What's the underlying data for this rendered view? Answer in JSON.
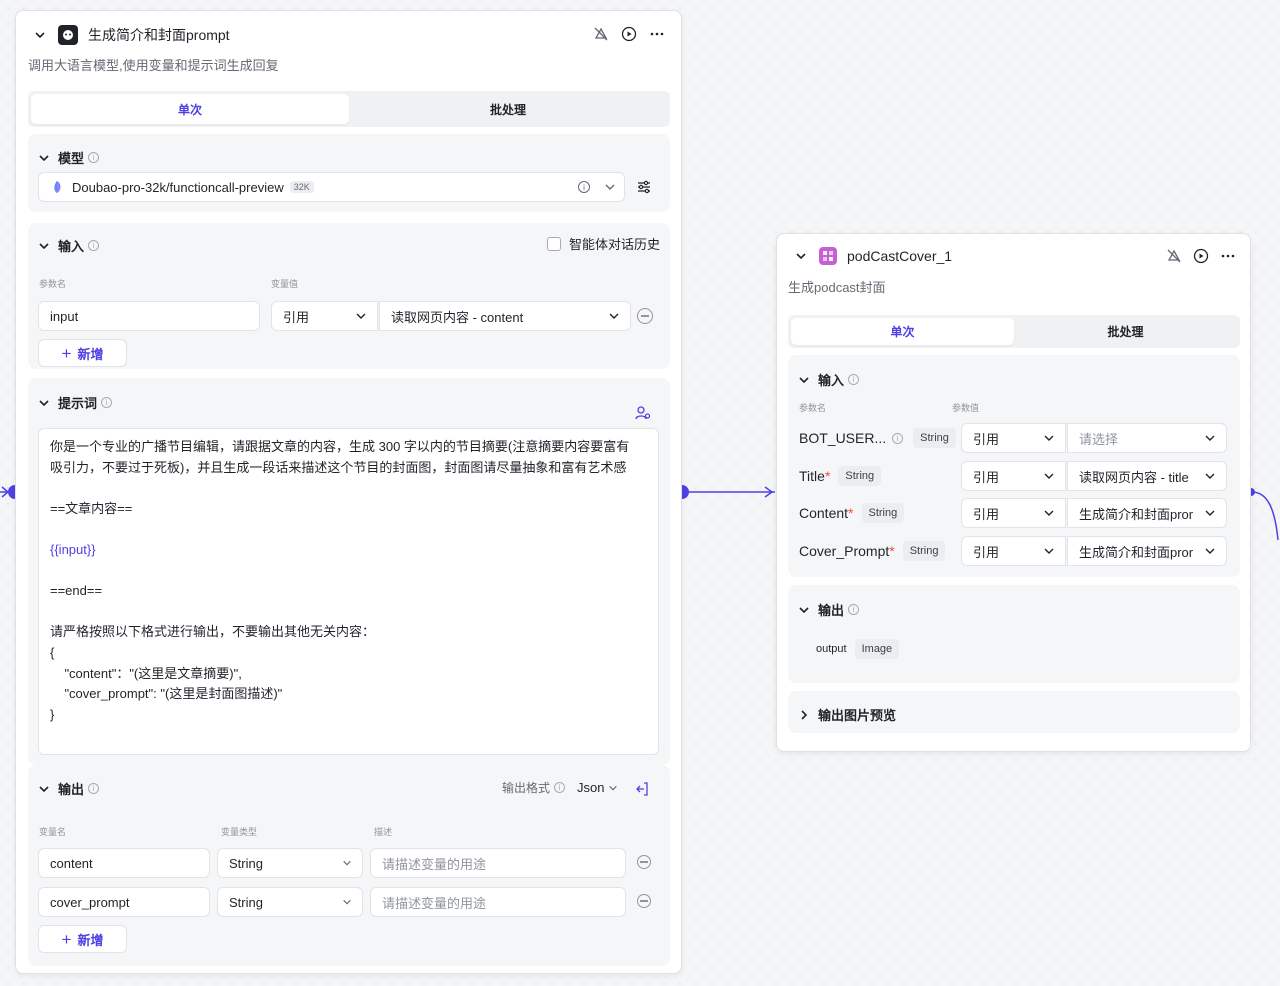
{
  "node1": {
    "title": "生成简介和封面prompt",
    "description": "调用大语言模型,使用变量和提示词生成回复",
    "tabs": [
      "单次",
      "批处理"
    ],
    "model": {
      "section_title": "模型",
      "name": "Doubao-pro-32k/functioncall-preview",
      "badge": "32K"
    },
    "input": {
      "section_title": "输入",
      "chat_history_label": "智能体对话历史",
      "col_param": "参数名",
      "col_value": "变量值",
      "rows": [
        {
          "name": "input",
          "type": "引用",
          "value": "读取网页内容 - content"
        }
      ],
      "add_label": "新增"
    },
    "prompt": {
      "section_title": "提示词",
      "line1": "你是一个专业的广播节目编辑，请跟据文章的内容，生成 300 字以内的节目摘要(注意摘要内容要富有",
      "line2": "吸引力，不要过于死板)，并且生成一段话来描述这个节目的封面图，封面图请尽量抽象和富有艺术感",
      "line3": "==文章内容==",
      "var": "{{input}}",
      "line4": "==end==",
      "line5": "请严格按照以下格式进行输出，不要输出其他无关内容：",
      "line6": "{",
      "line7": "    \"content\"：\"(这里是文章摘要)\",",
      "line8": "    \"cover_prompt\": \"(这里是封面图描述)\"",
      "line9": "}"
    },
    "output": {
      "section_title": "输出",
      "format_label": "输出格式",
      "format_value": "Json",
      "col_name": "变量名",
      "col_type": "变量类型",
      "col_desc": "描述",
      "rows": [
        {
          "name": "content",
          "type": "String",
          "placeholder": "请描述变量的用途"
        },
        {
          "name": "cover_prompt",
          "type": "String",
          "placeholder": "请描述变量的用途"
        }
      ],
      "add_label": "新增"
    }
  },
  "node2": {
    "title": "podCastCover_1",
    "description": "生成podcast封面",
    "tabs": [
      "单次",
      "批处理"
    ],
    "input": {
      "section_title": "输入",
      "col_param": "参数名",
      "col_value": "参数值",
      "rows": [
        {
          "name": "BOT_USER...",
          "required": "",
          "type": "String",
          "ref": "引用",
          "value": "请选择"
        },
        {
          "name": "Title",
          "required": "*",
          "type": "String",
          "ref": "引用",
          "value": "读取网页内容 - title"
        },
        {
          "name": "Content",
          "required": "*",
          "type": "String",
          "ref": "引用",
          "value": "生成简介和封面pror"
        },
        {
          "name": "Cover_Prompt",
          "required": "*",
          "type": "String",
          "ref": "引用",
          "value": "生成简介和封面pror"
        }
      ]
    },
    "output": {
      "section_title": "输出",
      "name": "output",
      "type": "Image"
    },
    "preview": {
      "section_title": "输出图片预览"
    }
  },
  "colors": {
    "accent": "#4e40e5",
    "required": "#f54a45",
    "node2_icon": "#c95fd6"
  }
}
